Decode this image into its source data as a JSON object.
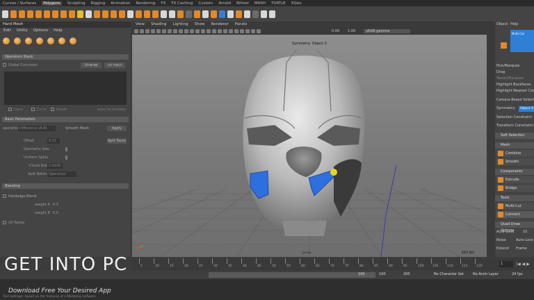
{
  "menus": [
    "Curves / Surfaces",
    "Polygons",
    "Sculpting",
    "Rigging",
    "Animation",
    "Rendering",
    "FX",
    "FX Caching",
    "Custom",
    "Arnold",
    "Bifrost",
    "MASH",
    "TURTLE",
    "XGen"
  ],
  "active_menu": "Polygons",
  "left_panel": {
    "title": "Hard Mesh",
    "menu": [
      "Edit",
      "Utility",
      "Options",
      "Help"
    ],
    "operators_stack": "Operators Stack",
    "unwrap": "Unwrap",
    "uv_input": "uv input",
    "global_concaves": "Global Concaves",
    "input": "Input",
    "curves": "Curve",
    "result": "Result",
    "auto_recalculate": "auto recalculate",
    "basic_parameters": "Basic Parameters",
    "operation_label": "operation",
    "operation_value": "Difference (A-B)",
    "smooth_mesh": "Smooth Mesh",
    "apply": "Apply",
    "offset_label": "Offset",
    "offset_value": "0.11",
    "split_faces": "Split Faces",
    "geometry_size": "Geometry Size",
    "uniform_splits": "Uniform Splits",
    "chord_dist": "Chord Dist",
    "chord_value": "0.0100",
    "split_before": "Split Before",
    "split_value": "Operation",
    "blending": "Blending",
    "hard_blend": "Hardedge Blend",
    "weight_a": "weight A",
    "weight_a_value": "0.3",
    "weight_b": "weight B",
    "weight_b_value": "0.0",
    "uv_ramp": "UV Ramp"
  },
  "viewport": {
    "menu": [
      "View",
      "Shading",
      "Lighting",
      "Show",
      "Renderer",
      "Panels"
    ],
    "label": "Symmetry: Object X",
    "camera": "persp",
    "fps": "103 fps",
    "gamma": "sRGB gamma",
    "val1": "0.00",
    "val2": "1.00"
  },
  "right_panel": {
    "tabs": [
      "Object",
      "Help"
    ],
    "tool": "Multi-Cut",
    "rows": [
      "Pick/Marquee",
      "Drag",
      "Tweak/Marquee",
      "Highlight Backfaces",
      "Highlight Nearest Component",
      "Camera Based Selection",
      "Symmetry:",
      "Selection Constraint:",
      "Transform Constraint:"
    ],
    "symmetry_value": "Object X",
    "soft_selection": "Soft Selection",
    "mesh": "Mesh",
    "combine": "Combine",
    "smooth": "Smooth",
    "components": "Components",
    "extrude": "Extrude",
    "bridge": "Bridge",
    "tools": "Tools",
    "multi_cut": "Multi-Cut",
    "connect": "Connect",
    "quad_draw": "Quad Draw Options",
    "auto_weld": "Auto-weld",
    "auto_weld_value": "10",
    "relax": "Relax",
    "auto_lock": "Auto-Lock",
    "extend": "Extend",
    "frame": "Frame"
  },
  "timeline": {
    "frames": [
      "5",
      "10",
      "15",
      "20",
      "25",
      "30",
      "35",
      "40",
      "45",
      "50",
      "55",
      "60",
      "65",
      "70",
      "75",
      "80",
      "85",
      "90",
      "95",
      "100",
      "105",
      "110",
      "115",
      "120"
    ],
    "current": "1"
  },
  "range": {
    "end_a": "100",
    "end_b": "100",
    "end_c": "200",
    "char_set": "No Character Set",
    "anim_layer": "No Anim Layer",
    "fps": "24 fps"
  },
  "watermark": {
    "get": "GET ",
    "into": "INTO",
    "pc": " PC",
    "sub": "Download Free Your Desired App",
    "tag": "Tool Settings: based on the features of a Modeling software"
  },
  "colors": {
    "accent": "#e08a2c",
    "select": "#3a7bd5",
    "panel": "#444444"
  }
}
